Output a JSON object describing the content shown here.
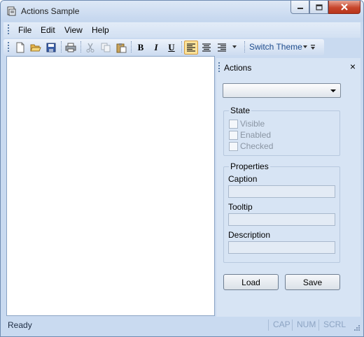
{
  "window": {
    "title": "Actions Sample"
  },
  "menu": {
    "items": [
      "File",
      "Edit",
      "View",
      "Help"
    ]
  },
  "toolbar": {
    "theme_label": "Switch Theme",
    "bold": "B",
    "italic": "I",
    "underline": "U"
  },
  "panel": {
    "title": "Actions",
    "close_glyph": "×",
    "combo_value": "",
    "state": {
      "legend": "State",
      "checkboxes": [
        "Visible",
        "Enabled",
        "Checked"
      ]
    },
    "properties": {
      "legend": "Properties",
      "caption_label": "Caption",
      "tooltip_label": "Tooltip",
      "description_label": "Description"
    },
    "load_label": "Load",
    "save_label": "Save"
  },
  "status": {
    "text": "Ready",
    "indicators": [
      "CAP",
      "NUM",
      "SCRL"
    ]
  },
  "colors": {
    "accent": "#1f4d8d",
    "active_button": "#fbe29a",
    "close_button": "#c7462c",
    "panel_bg": "#d7e4f4"
  },
  "icons": [
    "app-icon",
    "minimize-icon",
    "maximize-icon",
    "close-icon",
    "new-document-icon",
    "open-folder-icon",
    "save-icon",
    "print-icon",
    "cut-icon",
    "copy-icon",
    "paste-icon",
    "align-left-icon",
    "align-center-icon",
    "align-right-icon",
    "dropdown-arrow-icon",
    "size-grip-icon"
  ]
}
